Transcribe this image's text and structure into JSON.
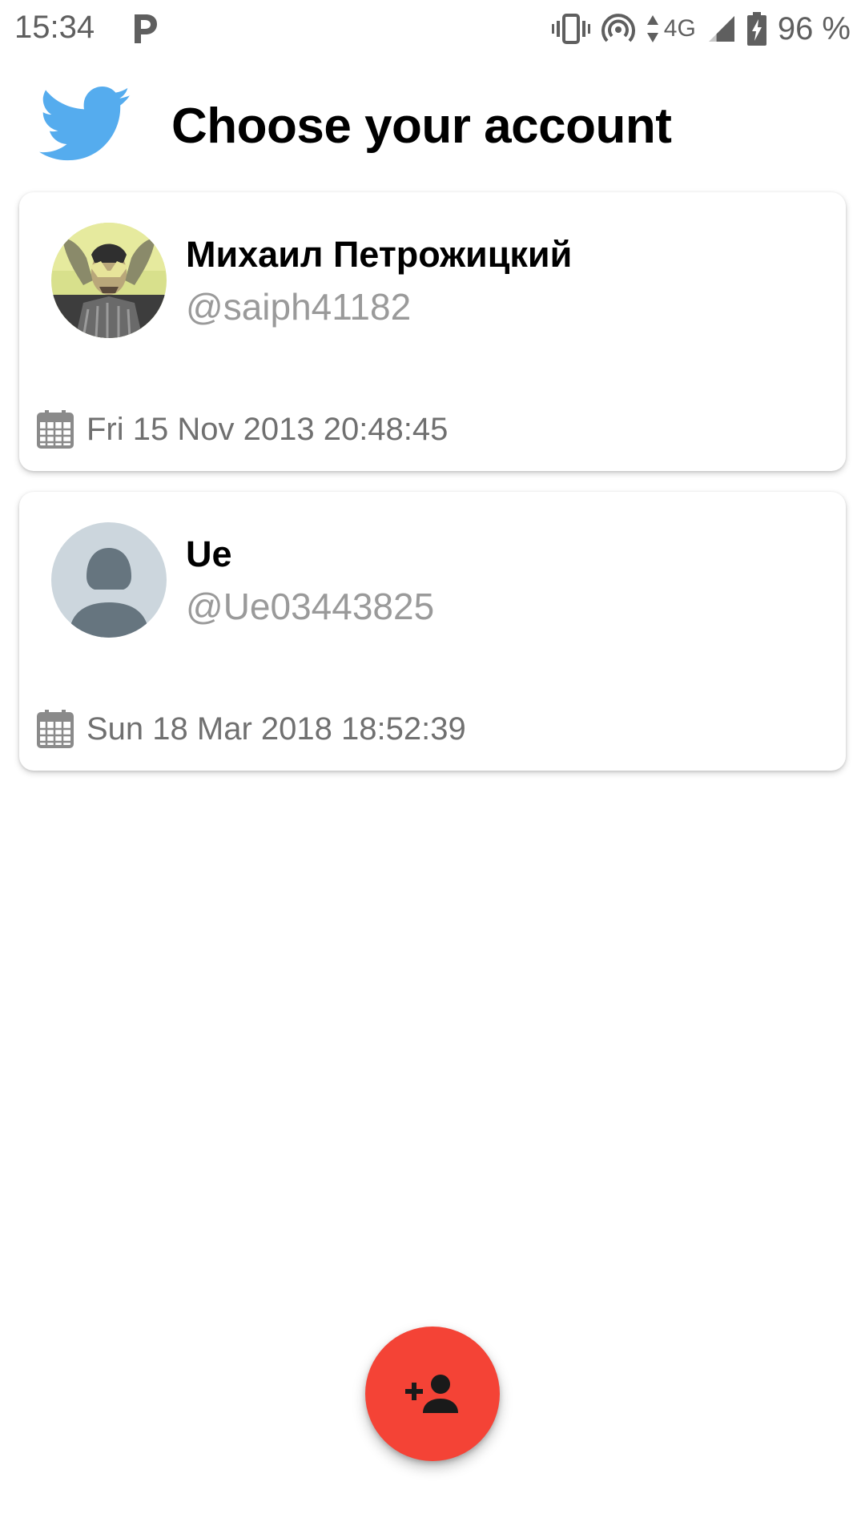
{
  "status_bar": {
    "time": "15:34",
    "network": "4G",
    "battery": "96 %",
    "icons": [
      "parking-icon",
      "vibrate-icon",
      "hotspot-icon",
      "network-arrows-icon",
      "signal-icon",
      "battery-charging-icon"
    ]
  },
  "header": {
    "title": "Choose your account",
    "logo": "twitter-bird-icon",
    "logo_color": "#55acee"
  },
  "accounts": [
    {
      "name": "Михаил Петрожицкий",
      "handle": "@saiph41182",
      "date": "Fri 15 Nov 2013 20:48:45",
      "avatar": "user-photo"
    },
    {
      "name": "Ue",
      "handle": "@Ue03443825",
      "date": "Sun 18 Mar 2018 18:52:39",
      "avatar": "default-avatar-icon"
    }
  ],
  "fab": {
    "icon": "add-person-icon",
    "color": "#f44336"
  }
}
